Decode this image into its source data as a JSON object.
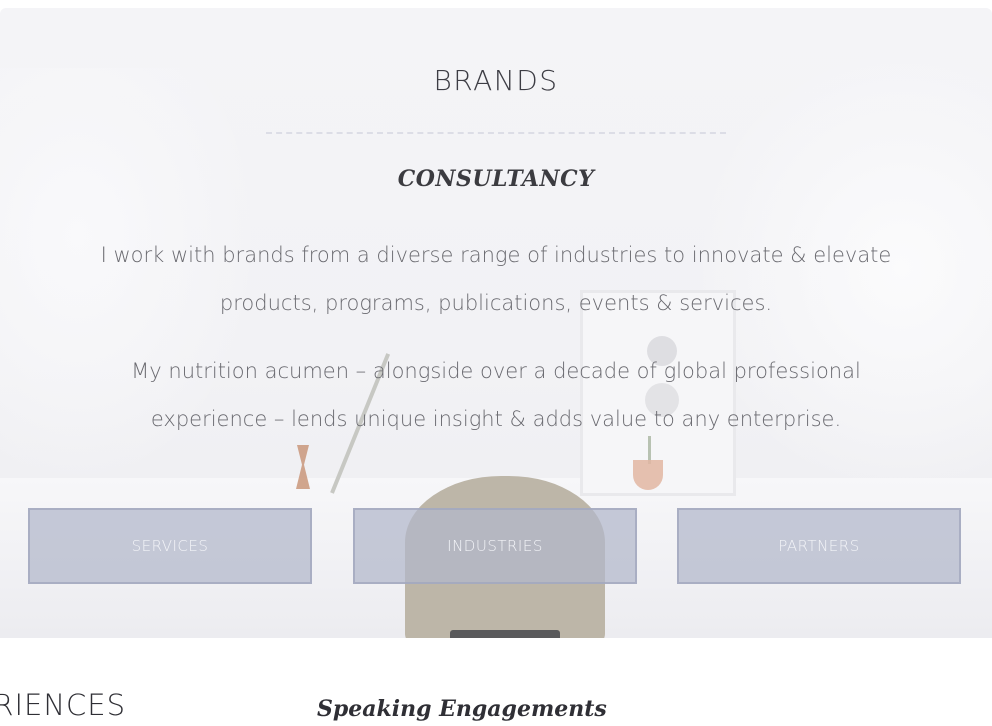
{
  "brands_section": {
    "title": "BRANDS",
    "subtitle": "CONSULTANCY",
    "paragraphs": [
      "I work with brands from a diverse range of industries to innovate & elevate products, programs, publications, events & services.",
      "My nutrition acumen – alongside over a decade of global professional experience – lends unique insight & adds value to any enterprise."
    ],
    "buttons": [
      {
        "label": "SERVICES"
      },
      {
        "label": "INDUSTRIES"
      },
      {
        "label": "PARTNERS"
      }
    ]
  },
  "next_section": {
    "left_heading": "ERIENCES",
    "right_heading": "Speaking Engagements"
  },
  "colors": {
    "button_fill": "#b2b7ca",
    "heading_text": "#3d3d44",
    "body_text": "#6a6a70"
  }
}
